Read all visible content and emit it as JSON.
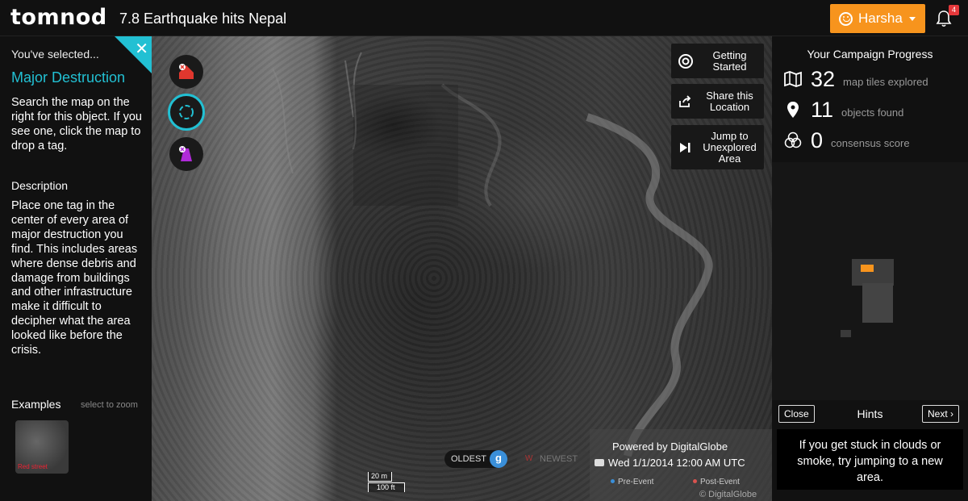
{
  "header": {
    "logo": "tomnod",
    "title": "7.8 Earthquake hits Nepal",
    "user_name": "Harsha",
    "notification_count": "4"
  },
  "sidebar": {
    "selected_label": "You've selected...",
    "object_name": "Major Destruction",
    "instructions": "Search the map on the right for this object. If you see one, click the map to drop a tag.",
    "description_title": "Description",
    "description": "Place one tag in the center of every area of major destruction you find. This includes areas where dense debris and damage from buildings and other infrastructure make it difficult to decipher what the area looked like before the crisis.",
    "examples_title": "Examples",
    "examples_hint": "select to zoom",
    "example_label": "Red street"
  },
  "map": {
    "tools": [
      {
        "name": "house-destroyed-tool",
        "color": "#e0372e"
      },
      {
        "name": "rotate-tool",
        "color": "#22c0d3"
      },
      {
        "name": "road-block-tool",
        "color": "#b02ad9"
      }
    ],
    "buttons": {
      "getting_started": "Getting Started",
      "share_location": "Share this Location",
      "jump_unexplored": "Jump to Unexplored Area"
    },
    "time": {
      "oldest": "OLDEST",
      "newest": "NEWEST",
      "knob_letter": "g",
      "newest_letter": "W"
    },
    "scale": {
      "metric": "20 m",
      "imperial": "100 ft"
    },
    "attribution": {
      "powered_by": "Powered by",
      "provider": "DigitalGlobe",
      "date": "Wed 1/1/2014 12:00 AM UTC",
      "pre_event": "Pre-Event",
      "post_event": "Post-Event",
      "copyright": "© DigitalGlobe",
      "pre_color": "#3a8fd9",
      "post_color": "#d9534f"
    }
  },
  "progress": {
    "title": "Your Campaign Progress",
    "stats": [
      {
        "icon": "map-icon",
        "value": "32",
        "label": "map tiles explored"
      },
      {
        "icon": "pin-icon",
        "value": "11",
        "label": "objects found"
      },
      {
        "icon": "consensus-icon",
        "value": "0",
        "label": "consensus score"
      }
    ]
  },
  "hints": {
    "close": "Close",
    "title": "Hints",
    "next": "Next",
    "text": "If you get stuck in clouds or smoke, try jumping to a new area."
  },
  "colors": {
    "accent": "#22c0d3",
    "brand_orange": "#f7941d"
  }
}
